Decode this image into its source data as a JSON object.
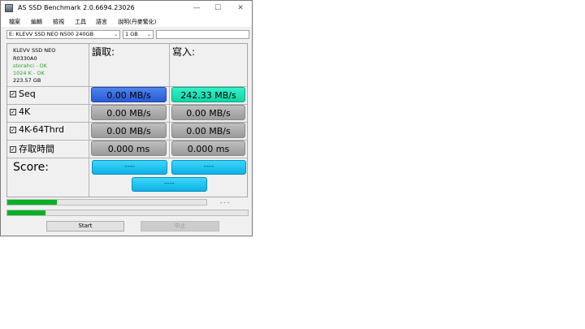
{
  "window": {
    "title": "AS SSD Benchmark 2.0.6694.23026",
    "controls": [
      "—",
      "☐",
      "✕"
    ]
  },
  "menu": [
    "檔案",
    "編輯",
    "檢視",
    "工具",
    "語言",
    "說明(丹麥繁化)"
  ],
  "toolbar": {
    "drive": "E: KLEVV SSD NEO N500 240GB",
    "size": "1 GB",
    "text_value": ""
  },
  "drive_info": {
    "model": "KLEVV SSD NEO",
    "firmware": "R0330A0",
    "driver": "storahci - OK",
    "alignment": "1024 K - OK",
    "capacity": "223.57 GB"
  },
  "columns": {
    "read": "讀取:",
    "write": "寫入:"
  },
  "rows": [
    {
      "label": "Seq",
      "read": "0.00 MB/s",
      "write": "242.33 MB/s"
    },
    {
      "label": "4K",
      "read": "0.00 MB/s",
      "write": "0.00 MB/s"
    },
    {
      "label": "4K-64Thrd",
      "read": "0.00 MB/s",
      "write": "0.00 MB/s"
    },
    {
      "label": "存取時間",
      "read": "0.000 ms",
      "write": "0.000 ms"
    }
  ],
  "score": {
    "label": "Score:",
    "read": "----",
    "write": "----",
    "total": "----"
  },
  "progress": {
    "bar1": 0.25,
    "bar2": 0.16,
    "time": "- - -"
  },
  "buttons": {
    "start": "Start",
    "abort": "中止"
  }
}
